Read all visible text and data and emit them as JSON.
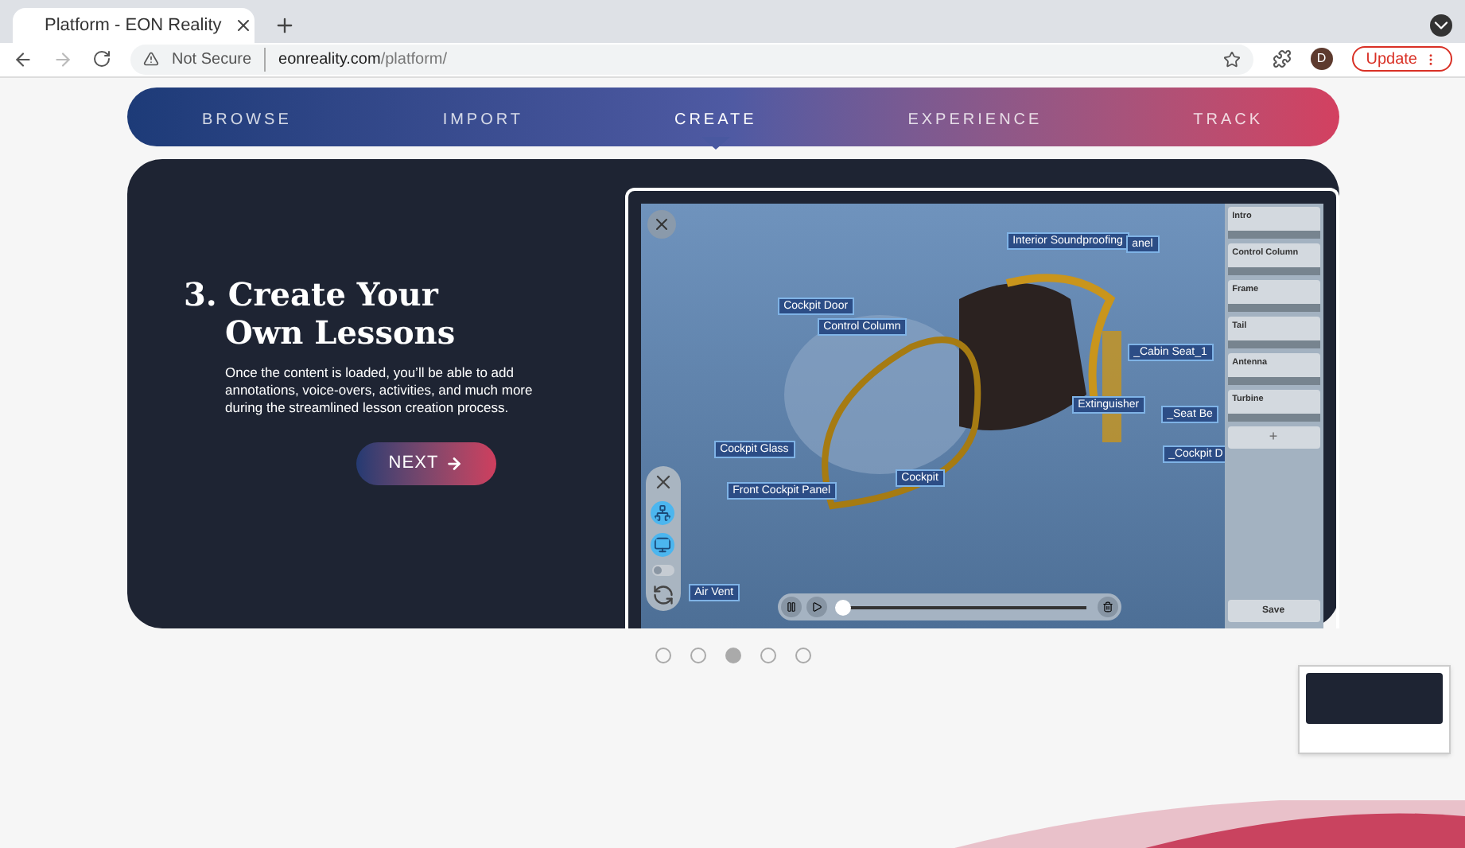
{
  "browser": {
    "tab_title": "Platform - EON Reality",
    "security": "Not Secure",
    "url_host": "eonreality.com",
    "url_path": "/platform/",
    "profile": "D",
    "update": "Update"
  },
  "nav": [
    {
      "label": "BROWSE",
      "selected": false
    },
    {
      "label": "IMPORT",
      "selected": false
    },
    {
      "label": "CREATE",
      "selected": true
    },
    {
      "label": "EXPERIENCE",
      "selected": false
    },
    {
      "label": "TRACK",
      "selected": false
    }
  ],
  "slide": {
    "title_line_1": "3. Create Your",
    "title_line_2": "Own Lessons",
    "body": "Once the content is loaded, you’ll be able to add annotations, voice-overs, activities, and much more during the streamlined lesson creation process.",
    "button": "NEXT"
  },
  "scene": {
    "labels": [
      {
        "text": "Interior Soundproofing"
      },
      {
        "text": "anel"
      },
      {
        "text": "Cockpit Door"
      },
      {
        "text": "Control Column"
      },
      {
        "text": "_Cabin Seat_1"
      },
      {
        "text": "Extinguisher"
      },
      {
        "text": "_Seat Be"
      },
      {
        "text": "Cockpit Glass"
      },
      {
        "text": "_Cockpit D"
      },
      {
        "text": "Front Cockpit Panel"
      },
      {
        "text": "Cockpit"
      },
      {
        "text": "Air Vent"
      }
    ],
    "toggle": {
      "on": false
    },
    "progress": {
      "level": 0.02
    }
  },
  "steps": [
    {
      "title": "Intro"
    },
    {
      "title": "Control Column"
    },
    {
      "title": "Frame"
    },
    {
      "title": "Tail"
    },
    {
      "title": "Antenna"
    },
    {
      "title": "Turbine"
    }
  ],
  "add_step": "+",
  "save": "Save",
  "dots": [
    {
      "selected": false
    },
    {
      "selected": false
    },
    {
      "selected": true
    },
    {
      "selected": false
    },
    {
      "selected": false
    }
  ]
}
